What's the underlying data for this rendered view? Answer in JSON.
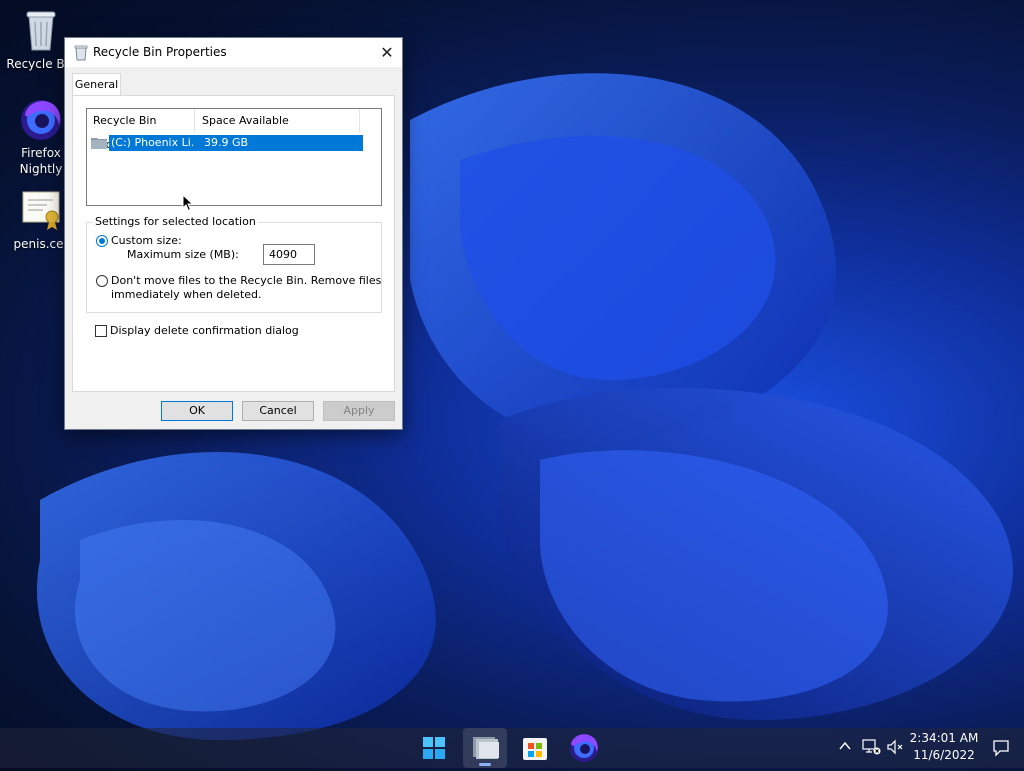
{
  "desktop": {
    "icons": [
      {
        "label": "Recycle Bin",
        "icon": "recycle-bin-icon"
      },
      {
        "label": "Firefox Nightly",
        "icon": "firefox-nightly-icon"
      },
      {
        "label": "penis.cer",
        "icon": "certificate-icon"
      }
    ]
  },
  "dialog": {
    "title": "Recycle Bin Properties",
    "close_glyph": "✕",
    "tab_general": "General",
    "list": {
      "col_location": "Recycle Bin Location",
      "col_space": "Space Available",
      "rows": [
        {
          "location": "(C:) Phoenix Li...",
          "space": "39.9 GB"
        }
      ]
    },
    "settings": {
      "group_label": "Settings for selected location",
      "custom_size": "Custom size:",
      "max_size_label": "Maximum size (MB):",
      "max_size_value": "4090",
      "dont_move_line1": "Don't move files to the Recycle Bin. Remove files",
      "dont_move_line2": "immediately when deleted."
    },
    "confirm_dialog": "Display delete confirmation dialog",
    "buttons": {
      "ok": "OK",
      "cancel": "Cancel",
      "apply": "Apply"
    }
  },
  "taskbar": {
    "clock_time": "2:34:01 AM",
    "clock_date": "11/6/2022",
    "apps": [
      "windows-start-icon",
      "file-explorer-icon",
      "microsoft-store-icon",
      "firefox-nightly-icon"
    ]
  },
  "colors": {
    "accent": "#0078d7",
    "selection": "#0078d7"
  }
}
